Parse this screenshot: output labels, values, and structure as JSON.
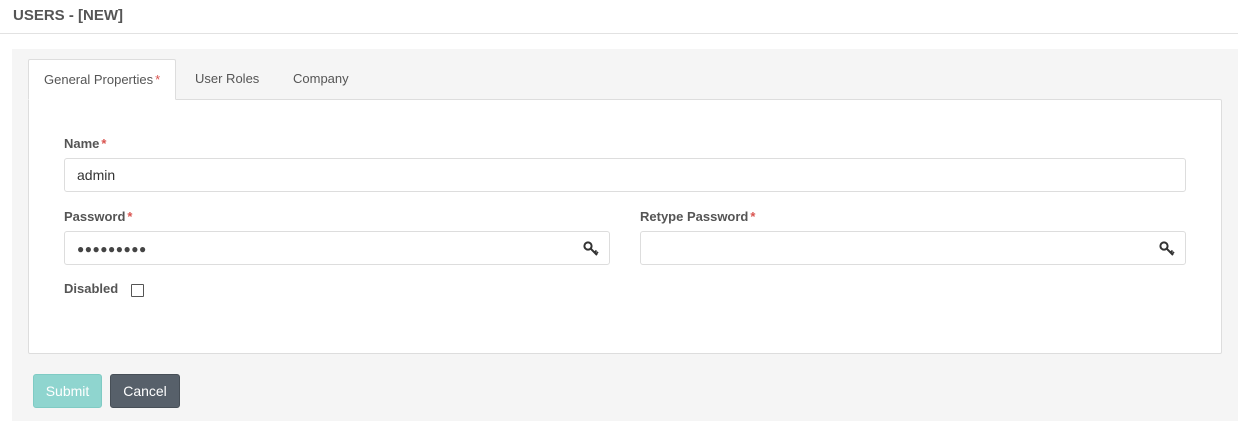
{
  "page": {
    "title": "USERS - [NEW]"
  },
  "tabs": [
    {
      "label": "General Properties",
      "required_mark": "*",
      "active": true
    },
    {
      "label": "User Roles"
    },
    {
      "label": "Company"
    }
  ],
  "form": {
    "name": {
      "label": "Name",
      "required_mark": "*",
      "value": "admin"
    },
    "password": {
      "label": "Password",
      "required_mark": "*",
      "value": "●●●●●●●●●",
      "icon": "key-icon"
    },
    "retype_password": {
      "label": "Retype Password",
      "required_mark": "*",
      "value": "",
      "icon": "key-icon"
    },
    "disabled": {
      "label": "Disabled",
      "checked": false
    }
  },
  "actions": {
    "submit_label": "Submit",
    "cancel_label": "Cancel"
  },
  "colors": {
    "required": "#d9534f",
    "submit_bg": "#8fd5cf",
    "cancel_bg": "#57606a",
    "panel_bg": "#f5f5f5"
  }
}
